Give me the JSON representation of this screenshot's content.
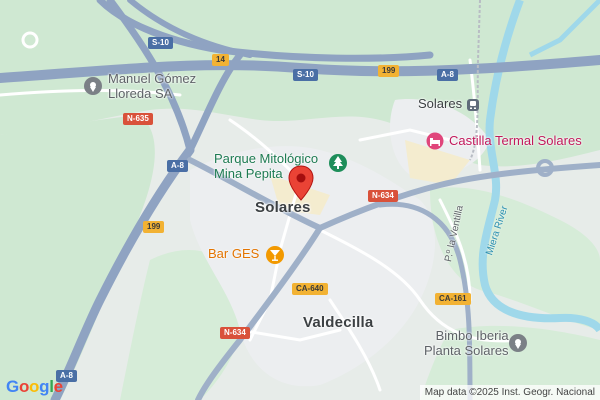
{
  "map": {
    "places": {
      "solares": "Solares",
      "valdecilla": "Valdecilla"
    },
    "pois": {
      "manuel_gomez_line1": "Manuel Gómez",
      "manuel_gomez_line2": "Lloreda SA",
      "parque_line1": "Parque Mitológico",
      "parque_line2": "Mina Pepita",
      "castilla_termal": "Castilla Termal Solares",
      "bar_ges": "Bar GES",
      "bimbo_line1": "Bimbo Iberia",
      "bimbo_line2": "Planta Solares",
      "station": "Solares"
    },
    "features": {
      "river": "Miera River",
      "street": "P.º la Ventilla"
    },
    "road_shields": {
      "s10_a": "S-10",
      "s10_b": "S-10",
      "a8_a": "A-8",
      "a8_b": "A-8",
      "a8_c": "A-8",
      "n635": "N-635",
      "n634_a": "N-634",
      "n634_b": "N-634",
      "r14": "14",
      "r199_a": "199",
      "r199_b": "199",
      "ca640": "CA-640",
      "ca161": "CA-161"
    },
    "logo": {
      "g1": "G",
      "o1": "o",
      "o2": "o",
      "g2": "g",
      "l": "l",
      "e": "e"
    },
    "attribution": "Map data ©2025 Inst. Geogr. Nacional",
    "colors": {
      "land": "#e7ece9",
      "forest": "#cfe8d2",
      "motorway": "#8fa3c2",
      "river": "#9fd8ea",
      "pin": "#ea4335"
    }
  }
}
